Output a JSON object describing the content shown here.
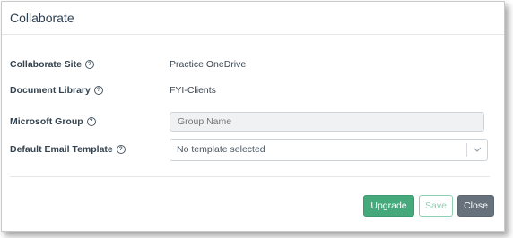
{
  "dialog": {
    "title": "Collaborate"
  },
  "fields": {
    "collaborate_site": {
      "label": "Collaborate Site",
      "value": "Practice OneDrive"
    },
    "document_library": {
      "label": "Document Library",
      "value": "FYI-Clients"
    },
    "microsoft_group": {
      "label": "Microsoft Group",
      "placeholder": "Group Name"
    },
    "default_email_template": {
      "label": "Default Email Template",
      "selected": "No template selected"
    }
  },
  "help_glyph": "?",
  "buttons": {
    "upgrade": "Upgrade",
    "save": "Save",
    "close": "Close"
  },
  "colors": {
    "upgrade_bg": "#45a97c",
    "save_border": "#8fcfb2",
    "close_bg": "#66717b",
    "title_text": "#2e3e4e"
  },
  "icons": {
    "help": "help-circle-icon",
    "dropdown": "chevron-down-icon"
  }
}
